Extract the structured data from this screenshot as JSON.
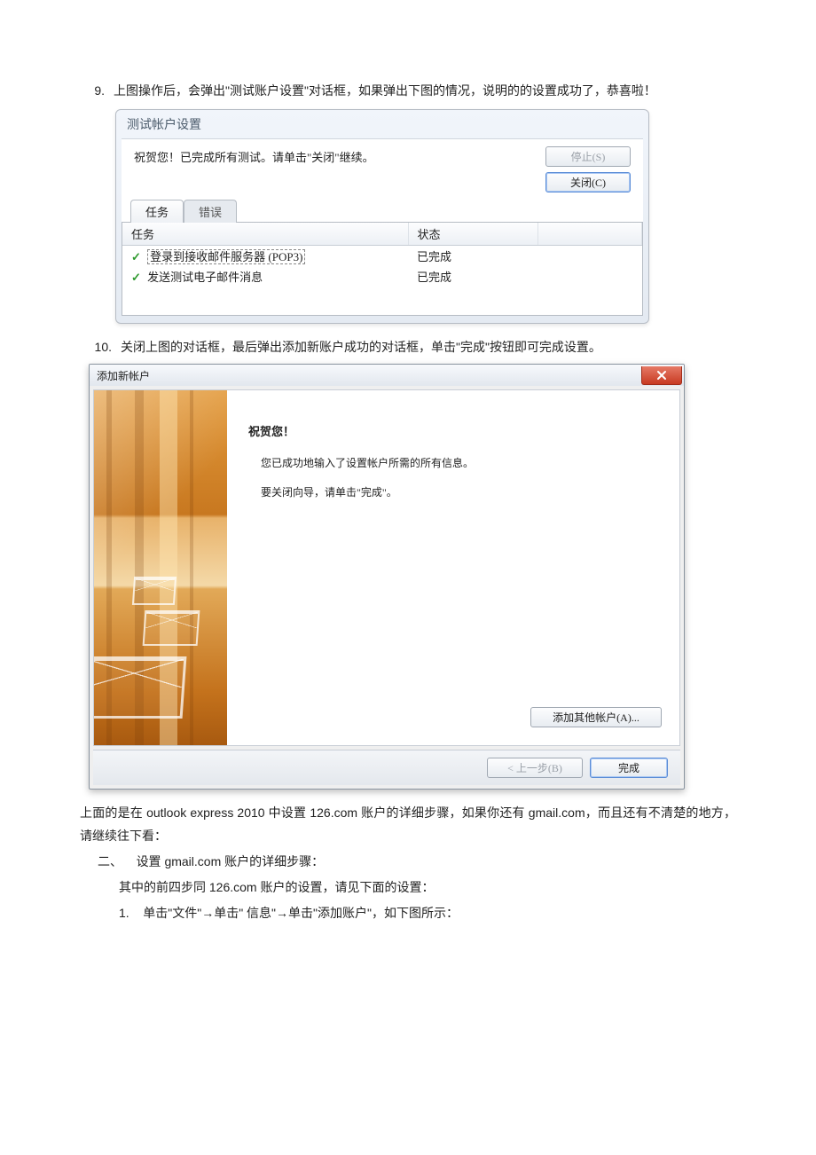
{
  "step9": {
    "num": "9.",
    "text": "上图操作后，会弹出\"测试账户设置\"对话框，如果弹出下图的情况，说明的的设置成功了，恭喜啦！"
  },
  "dlg1": {
    "title": "测试帐户设置",
    "message": "祝贺您！已完成所有测试。请单击\"关闭\"继续。",
    "btn_stop": "停止(S)",
    "btn_close": "关闭(C)",
    "tab_tasks": "任务",
    "tab_errors": "错误",
    "col_task": "任务",
    "col_status": "状态",
    "rows": [
      {
        "task": "登录到接收邮件服务器 (POP3)",
        "status": "已完成"
      },
      {
        "task": "发送测试电子邮件消息",
        "status": "已完成"
      }
    ]
  },
  "step10": {
    "num": "10.",
    "text": "关闭上图的对话框，最后弹出添加新账户成功的对话框，单击\"完成\"按钮即可完成设置。"
  },
  "dlg2": {
    "title": "添加新帐户",
    "heading": "祝贺您！",
    "line1": "您已成功地输入了设置帐户所需的所有信息。",
    "line2": "要关闭向导，请单击\"完成\"。",
    "btn_add_other": "添加其他帐户(A)...",
    "btn_back": "< 上一步(B)",
    "btn_finish": "完成"
  },
  "para1": "上面的是在 outlook express 2010 中设置 126.com 账户的详细步骤，如果你还有 gmail.com，而且还有不清楚的地方，请继续往下看：",
  "section2": {
    "num": "二、",
    "title": "设置 gmail.com 账户的详细步骤：",
    "sub": "其中的前四步同 126.com 账户的设置，请见下面的设置：",
    "item1_num": "1.",
    "item1_text": "单击\"文件\"→单击\" 信息\"→单击\"添加账户\"，如下图所示："
  }
}
